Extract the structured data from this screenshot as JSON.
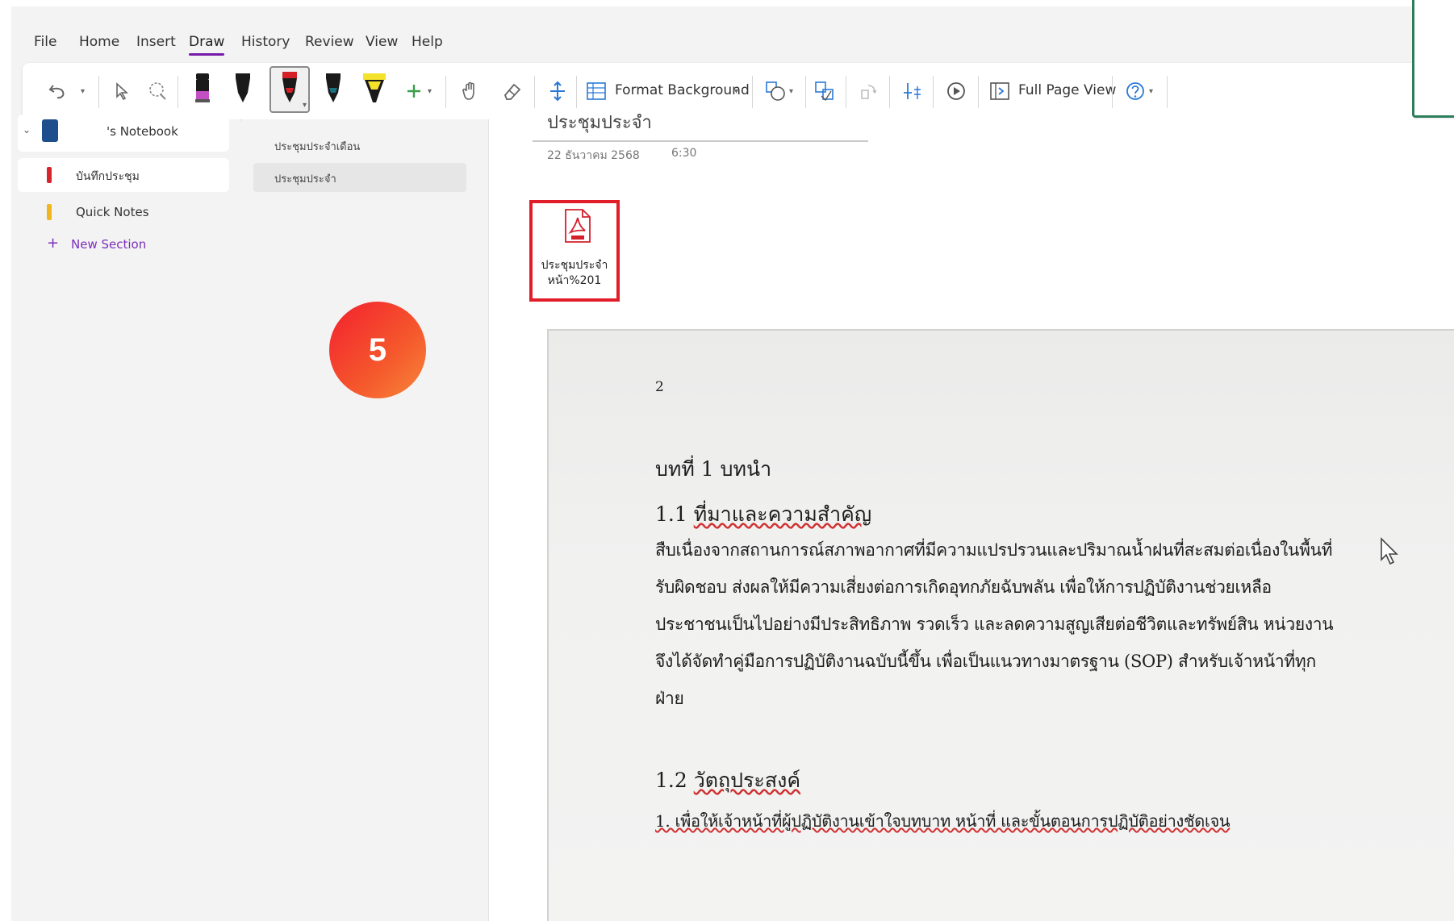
{
  "menu": {
    "tabs": [
      {
        "label": "File"
      },
      {
        "label": "Home"
      },
      {
        "label": "Insert"
      },
      {
        "label": "Draw"
      },
      {
        "label": "History"
      },
      {
        "label": "Review"
      },
      {
        "label": "View"
      },
      {
        "label": "Help"
      }
    ],
    "active": "Draw"
  },
  "ribbon": {
    "format_background": "Format Background",
    "full_page_view": "Full Page View",
    "pens": [
      {
        "name": "pink-pen",
        "color": "#c34fc4"
      },
      {
        "name": "black-pen",
        "color": "#1a1a1a"
      },
      {
        "name": "red-pen",
        "color": "#d41f26"
      },
      {
        "name": "teal-pen",
        "color": "#1a6f80"
      },
      {
        "name": "yellow-highlighter",
        "color": "#f5e22a"
      }
    ],
    "accent_green": "#3a9e4b",
    "accent_blue": "#2b79d6"
  },
  "nav": {
    "notebook": "'s Notebook",
    "sections": [
      {
        "label": "บันทึกประชุม",
        "color": "#d7262b"
      },
      {
        "label": "Quick Notes",
        "color": "#f2b520"
      }
    ],
    "new_section": "New Section",
    "new_section_color": "#7b2fb9"
  },
  "pages": [
    {
      "label": "ประชุมประจำเดือน"
    },
    {
      "label": "ประชุมประจำ"
    }
  ],
  "page": {
    "title": "ประชุมประจำ",
    "date": "22 ธันวาคม 2568",
    "time": "6:30",
    "attachment": {
      "line1": "ประชุมประจำ",
      "line2": "หน้า%201",
      "icon": "pdf-icon"
    }
  },
  "document": {
    "page_number": "2",
    "chapter": "บทที่ 1 บทนำ",
    "sec1": {
      "num": "1.1",
      "title": "ที่มาและความสำคัญ"
    },
    "para": [
      "สืบเนื่องจากสถานการณ์สภาพอากาศที่มีความแปรปรวนและปริมาณน้ำฝนที่สะสมต่อเนื่องในพื้นที่",
      "รับผิดชอบ ส่งผลให้มีความเสี่ยงต่อการเกิดอุทกภัยฉับพลัน เพื่อให้การปฏิบัติงานช่วยเหลือ",
      "ประชาชนเป็นไปอย่างมีประสิทธิภาพ รวดเร็ว และลดความสูญเสียต่อชีวิตและทรัพย์สิน หน่วยงาน",
      "จึงได้จัดทำคู่มือการปฏิบัติงานฉบับนี้ขึ้น เพื่อเป็นแนวทางมาตรฐาน (SOP) สำหรับเจ้าหน้าที่ทุก",
      "ฝ่าย"
    ],
    "sec2": {
      "num": "1.2",
      "title": "วัตถุประสงค์"
    },
    "obj1": "1. เพื่อให้เจ้าหน้าที่ผู้ปฏิบัติงานเข้าใจบทบาท หน้าที่ และขั้นตอนการปฏิบัติอย่างชัดเจน"
  },
  "step_badge": "5"
}
